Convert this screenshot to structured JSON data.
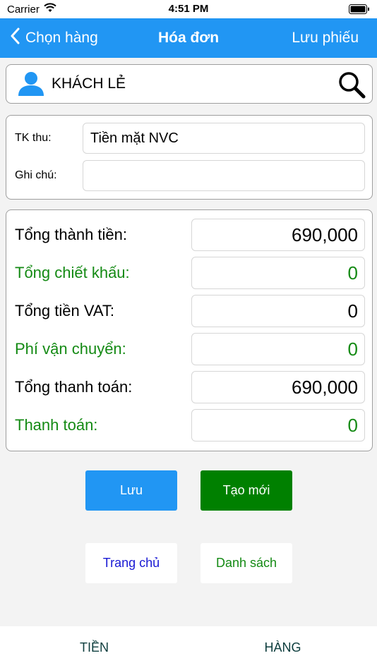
{
  "status_bar": {
    "carrier": "Carrier",
    "time": "4:51 PM"
  },
  "nav": {
    "back_label": "Chọn hàng",
    "title": "Hóa đơn",
    "right_label": "Lưu phiếu"
  },
  "customer": {
    "name": "KHÁCH LẺ"
  },
  "info": {
    "account_label": "TK thu:",
    "account_value": "Tiền mặt NVC",
    "note_label": "Ghi chú:",
    "note_value": ""
  },
  "totals": [
    {
      "label": "Tổng thành tiền:",
      "value": "690,000",
      "color": "#000000"
    },
    {
      "label": "Tổng chiết khấu:",
      "value": "0",
      "color": "#148a14"
    },
    {
      "label": "Tổng tiền VAT:",
      "value": "0",
      "color": "#000000"
    },
    {
      "label": "Phí vận chuyển:",
      "value": "0",
      "color": "#148a14"
    },
    {
      "label": "Tổng thanh toán:",
      "value": "690,000",
      "color": "#000000"
    },
    {
      "label": "Thanh toán:",
      "value": "0",
      "color": "#148a14"
    }
  ],
  "buttons": {
    "save": "Lưu",
    "new": "Tạo mới",
    "home": "Trang chủ",
    "list": "Danh sách"
  },
  "tabs": {
    "tien": "TIỀN",
    "hang": "HÀNG"
  },
  "colors": {
    "accent": "#2196f3",
    "green": "#008000",
    "link_blue": "#1a1ad4"
  },
  "icons": [
    "back-chevron-icon",
    "user-icon",
    "search-icon",
    "wifi-icon",
    "battery-icon"
  ]
}
